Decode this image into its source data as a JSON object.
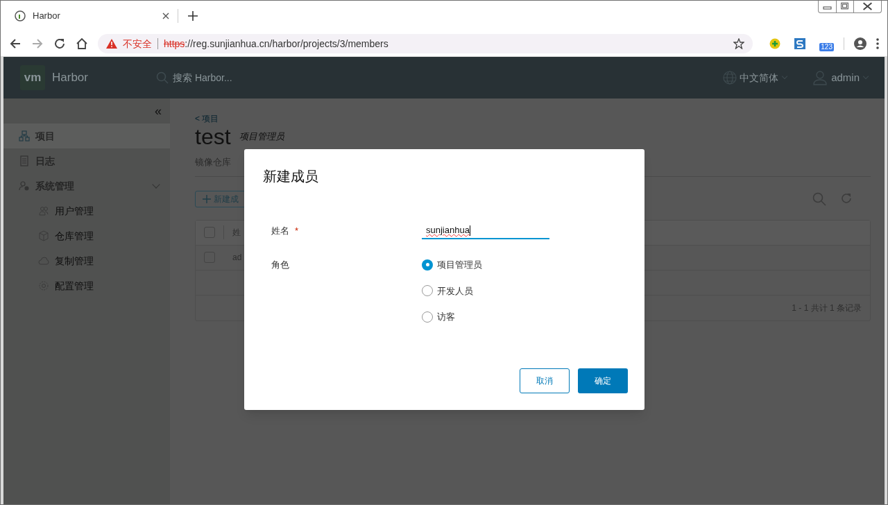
{
  "browser": {
    "tab_title": "Harbor",
    "insecure_label": "不安全",
    "url_scheme": "https",
    "url_rest": "://reg.sunjianhua.cn/harbor/projects/3/members",
    "extension_badge": "123"
  },
  "header": {
    "logo": "vm",
    "brand": "Harbor",
    "search_placeholder": "搜索 Harbor...",
    "language": "中文简体",
    "user": "admin"
  },
  "sidebar": {
    "items": [
      {
        "label": "项目",
        "selected": true
      },
      {
        "label": "日志",
        "selected": false
      },
      {
        "label": "系统管理",
        "selected": false,
        "expanded": true,
        "children": [
          {
            "label": "用户管理",
            "selected": false
          },
          {
            "label": "仓库管理",
            "selected": false
          },
          {
            "label": "复制管理",
            "selected": false
          },
          {
            "label": "配置管理",
            "selected": false
          }
        ]
      }
    ],
    "collapse": "«"
  },
  "project": {
    "breadcrumb": "< 项目",
    "title": "test",
    "role": "项目管理员",
    "tabs": [
      {
        "label": "镜像仓库",
        "selected": false
      }
    ],
    "new_member_button": "新建成",
    "table": {
      "header_checked": false,
      "column_1": "姓",
      "rows": [
        {
          "column_1": "ad",
          "checked": false
        }
      ]
    },
    "pagination": "1 - 1 共计 1 条记录"
  },
  "dialog": {
    "title": "新建成员",
    "name_label": "姓名",
    "required_mark": "*",
    "name_value": "sunjianhua",
    "role_label": "角色",
    "roles": [
      {
        "label": "项目管理员",
        "selected": true
      },
      {
        "label": "开发人员",
        "selected": false
      },
      {
        "label": "访客",
        "selected": false
      }
    ],
    "buttons": [
      {
        "label": "取消",
        "kind": "secondary"
      },
      {
        "label": "确定",
        "kind": "primary"
      }
    ]
  }
}
